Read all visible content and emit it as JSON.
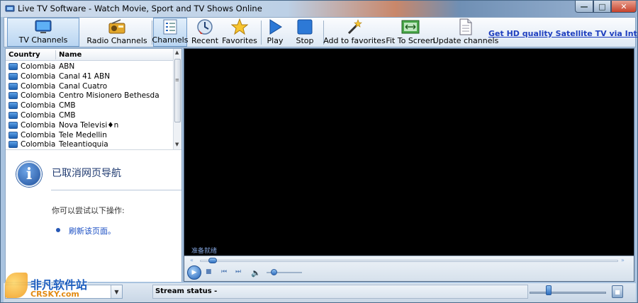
{
  "window": {
    "title": "Live TV Software - Watch Movie, Sport and TV Shows Online"
  },
  "toolbar": {
    "items": [
      {
        "label": "TV Channels",
        "icon": "tv-icon"
      },
      {
        "label": "Radio Channels",
        "icon": "radio-icon"
      },
      {
        "label": "Channels",
        "icon": "list-icon"
      },
      {
        "label": "Recent",
        "icon": "recent-icon"
      },
      {
        "label": "Favorites",
        "icon": "star-icon"
      },
      {
        "label": "Play",
        "icon": "play-icon"
      },
      {
        "label": "Stop",
        "icon": "stop-icon"
      },
      {
        "label": "Add to favorites",
        "icon": "magic-wand-icon"
      },
      {
        "label": "Fit To Screen",
        "icon": "fit-screen-icon"
      },
      {
        "label": "Update channels",
        "icon": "document-icon"
      }
    ],
    "promo_link": "Get HD quality Satellite TV via Internet"
  },
  "channel_list": {
    "columns": [
      "Country",
      "Name"
    ],
    "rows": [
      {
        "country": "Colombia",
        "name": "ABN"
      },
      {
        "country": "Colombia",
        "name": "Canal 41 ABN"
      },
      {
        "country": "Colombia",
        "name": "Canal Cuatro"
      },
      {
        "country": "Colombia",
        "name": "Centro Misionero Bethesda"
      },
      {
        "country": "Colombia",
        "name": "CMB"
      },
      {
        "country": "Colombia",
        "name": "CMB"
      },
      {
        "country": "Colombia",
        "name": "Nova Televisi♦n"
      },
      {
        "country": "Colombia",
        "name": "Tele Medellin"
      },
      {
        "country": "Colombia",
        "name": "Teleantioquia"
      }
    ]
  },
  "error_panel": {
    "title": "已取消网页导航",
    "try_text": "你可以尝试以下操作:",
    "refresh_link": "刷新该页面。"
  },
  "player": {
    "status_text": "准备就绪",
    "seek_position": 0.02,
    "volume_level": 0.2
  },
  "statusbar": {
    "stream_status_label": "Stream status -",
    "slider_level": 0.25
  },
  "watermark": {
    "cn": "非凡软件站",
    "en": "CRSKY.com"
  },
  "colors": {
    "accent": "#1e3fbf",
    "player_bg": "#000000",
    "window": "#a9c3df"
  }
}
